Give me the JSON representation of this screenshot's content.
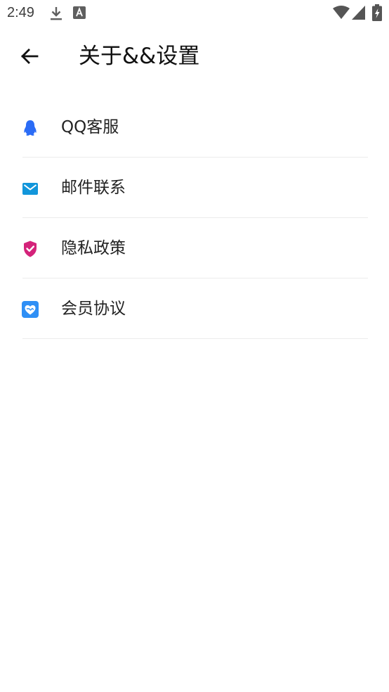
{
  "status_bar": {
    "time": "2:49",
    "icons": [
      "download-icon",
      "text-a-icon",
      "wifi-icon",
      "signal-icon",
      "battery-charging-icon"
    ]
  },
  "header": {
    "title": "关于&&设置",
    "back_icon": "arrow-left-icon"
  },
  "menu": {
    "items": [
      {
        "label": "QQ客服",
        "icon": "qq-penguin-icon",
        "icon_color": "#2b6cf6"
      },
      {
        "label": "邮件联系",
        "icon": "mail-icon",
        "icon_color": "#1296db"
      },
      {
        "label": "隐私政策",
        "icon": "privacy-shield-icon",
        "icon_color": "#d4237a"
      },
      {
        "label": "会员协议",
        "icon": "member-agreement-icon",
        "icon_color": "#2f8ff5"
      }
    ]
  }
}
